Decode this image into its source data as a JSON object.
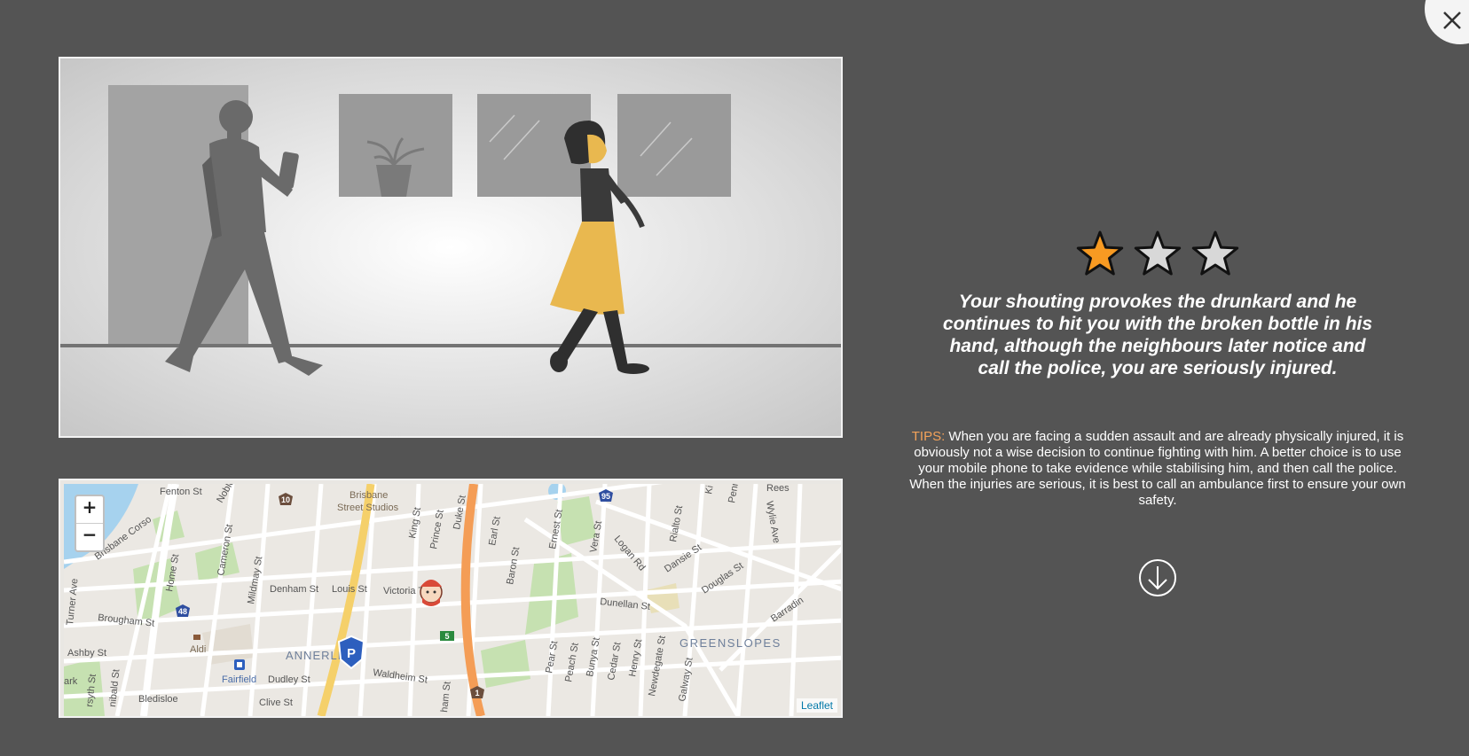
{
  "rating": {
    "value": 1,
    "max": 3
  },
  "result_text": "Your shouting provokes the drunkard and he continues to hit you with the broken bottle in his hand, although the neighbours later notice and call the police, you are seriously injured.",
  "tips": {
    "label": "TIPS:",
    "text": " When you are facing a sudden assault and are already physically injured, it is obviously not a wise decision to continue fighting with him. A better choice is to use your mobile phone to take evidence while stabilising him, and then call the police. When the injuries are serious, it is best to call an ambulance first to ensure your own safety."
  },
  "map": {
    "zoom_in": "+",
    "zoom_out": "−",
    "attribution": "Leaflet",
    "labels": {
      "fenton_st": "Fenton St",
      "brisbane_corso": "Brisbane Corso",
      "noble": "Noble",
      "brisbane": "Brisbane",
      "street_studios": "Street Studios",
      "king_st": "King St",
      "prince_st": "Prince St",
      "duke_st": "Duke St",
      "earl_st": "Earl St",
      "ernest_st": "Ernest St",
      "vera_st": "Vera St",
      "logan_rd": "Logan Rd",
      "rialto_st": "Rialto St",
      "dansie_st": "Dansie St",
      "douglas_st": "Douglas St",
      "wylie_ave": "Wylie Ave",
      "reese": "Rees",
      "penn": "Penn",
      "ki": "Ki",
      "turner_ave": "Turner Ave",
      "home_st": "Home St",
      "cameron_st": "Cameron St",
      "mildmay_st": "Mildmay St",
      "denham_st": "Denham St",
      "louis_st": "Louis St",
      "victoria_t": "Victoria T",
      "baron_st": "Baron St",
      "dunellan_st": "Dunellan St",
      "brougham_st": "Brougham St",
      "ashby_st": "Ashby St",
      "aldi": "Aldi",
      "annerley": "ANNERLEY",
      "waldheim_st": "Waldheim St",
      "fairfield": "Fairfield",
      "dudley_st": "Dudley St",
      "pear_st": "Pear St",
      "peach_st": "Peach St",
      "bunya_st": "Bunya St",
      "cedar_st": "Cedar St",
      "henry_st": "Henry St",
      "newdegate_st": "Newdegate St",
      "galway_st": "Galway St",
      "greenslopes": "GREENSLOPES",
      "barradine": "Barradin",
      "clive_st": "Clive St",
      "bledisloe": "Bledisloe",
      "ark": "ark",
      "nibald_st": "nibald St",
      "forsyth_st": "rsyth St",
      "graham_st": "ham St",
      "shield_10": "10",
      "shield_95": "95",
      "shield_48": "48",
      "shield_5": "5",
      "shield_1": "1"
    }
  },
  "colors": {
    "background": "#545454",
    "star_active": "#f79a22",
    "star_inactive": "#d8d8d8",
    "tips_label": "#f3a25a"
  }
}
